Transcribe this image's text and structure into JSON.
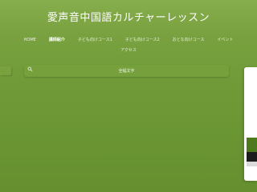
{
  "site": {
    "title": "愛声音中国語カルチャーレッスン"
  },
  "nav": {
    "items": [
      {
        "label": "HOME"
      },
      {
        "label": "講師紹介",
        "active": true
      },
      {
        "label": "子ども向けコース1"
      },
      {
        "label": "子ども向けコース2"
      },
      {
        "label": "おとな向けコース"
      },
      {
        "label": "イベント"
      },
      {
        "label": "アクセス"
      }
    ]
  },
  "search": {
    "label": "全幅文字",
    "icon": "search-icon"
  },
  "colors": {
    "background": "#6f9a37",
    "header": "#86ae4c",
    "text": "#ffffff",
    "panel": "#ffffff"
  }
}
